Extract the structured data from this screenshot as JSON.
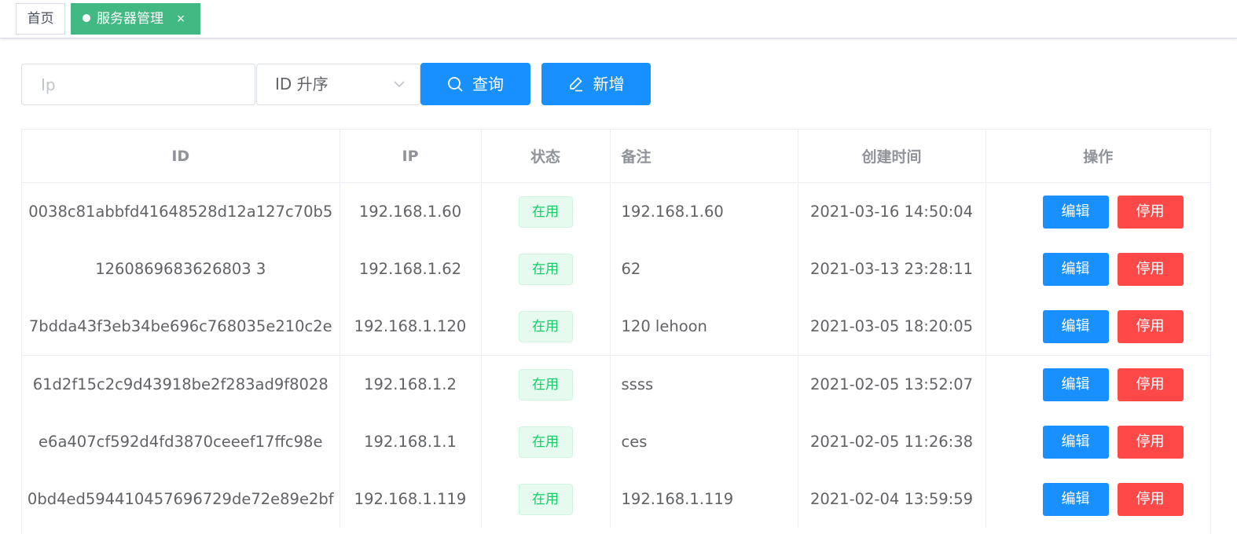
{
  "tabs": {
    "home_label": "首页",
    "active_label": "服务器管理",
    "close_glyph": "×"
  },
  "filter": {
    "ip_placeholder": "Ip",
    "sort_value": "ID 升序",
    "query_label": "查询",
    "add_label": "新增"
  },
  "table": {
    "headers": {
      "id": "ID",
      "ip": "IP",
      "status": "状态",
      "remark": "备注",
      "created": "创建时间",
      "actions": "操作"
    },
    "rows": [
      {
        "id": "0038c81abbfd41648528d12a127c70b5",
        "ip": "192.168.1.60",
        "status": "在用",
        "remark": "192.168.1.60",
        "created": "2021-03-16 14:50:04",
        "edit": "编辑",
        "disable": "停用"
      },
      {
        "id": "1260869683626803 3",
        "ip": "192.168.1.62",
        "status": "在用",
        "remark": "62",
        "created": "2021-03-13 23:28:11",
        "edit": "编辑",
        "disable": "停用"
      },
      {
        "id": "7bdda43f3eb34be696c768035e210c2e",
        "ip": "192.168.1.120",
        "status": "在用",
        "remark": "120 lehoon",
        "created": "2021-03-05 18:20:05",
        "edit": "编辑",
        "disable": "停用"
      },
      {
        "id": "61d2f15c2c9d43918be2f283ad9f8028",
        "ip": "192.168.1.2",
        "status": "在用",
        "remark": "ssss",
        "created": "2021-02-05 13:52:07",
        "edit": "编辑",
        "disable": "停用"
      },
      {
        "id": "e6a407cf592d4fd3870ceeef17ffc98e",
        "ip": "192.168.1.1",
        "status": "在用",
        "remark": "ces",
        "created": "2021-02-05 11:26:38",
        "edit": "编辑",
        "disable": "停用"
      },
      {
        "id": "0bd4ed594410457696729de72e89e2bf",
        "ip": "192.168.1.119",
        "status": "在用",
        "remark": "192.168.1.119",
        "created": "2021-02-04 13:59:59",
        "edit": "编辑",
        "disable": "停用"
      }
    ]
  },
  "colors": {
    "primary": "#1890ff",
    "tab_active": "#42b983",
    "danger": "#ff4949",
    "success_text": "#13ce66"
  }
}
